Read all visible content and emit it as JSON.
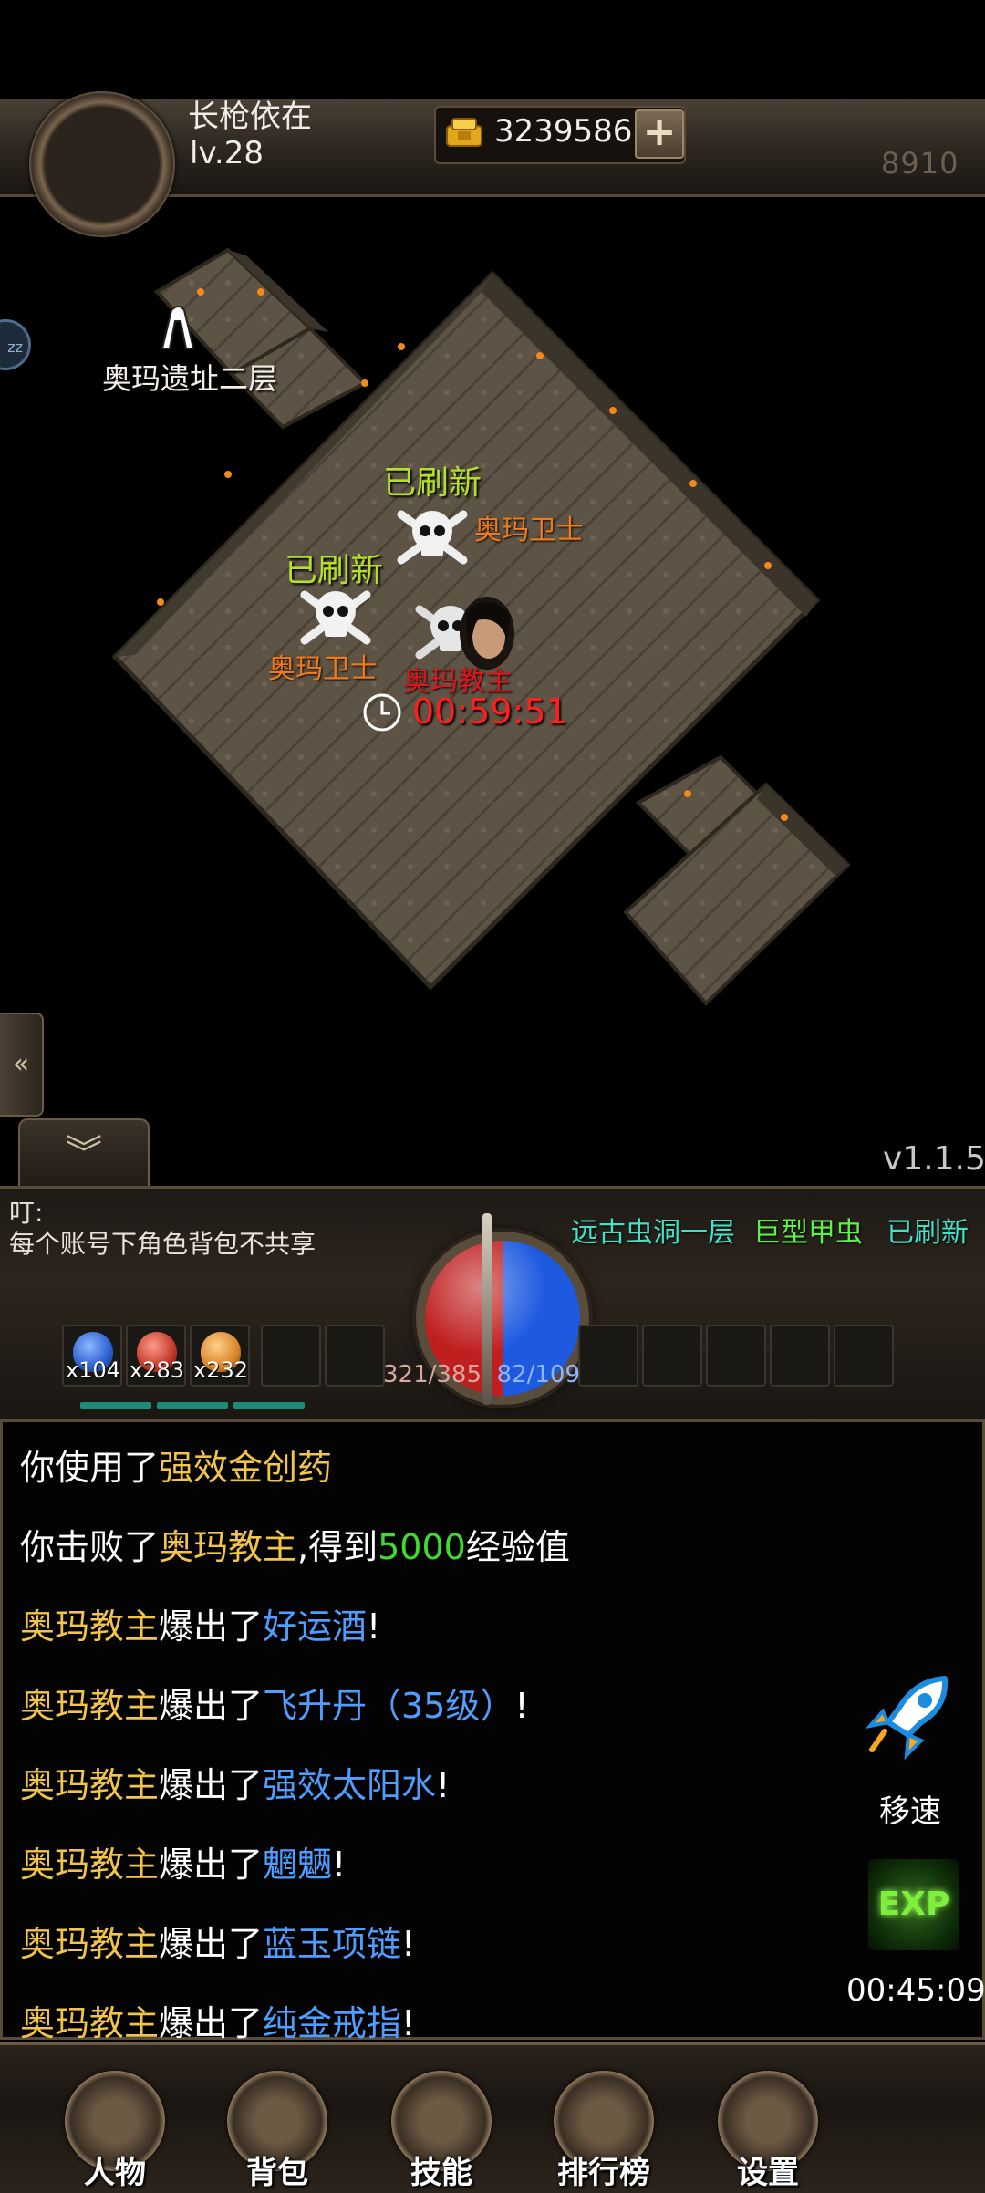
{
  "player": {
    "name": "长枪依在",
    "level": "lv.28",
    "gold": "3239586",
    "power": "8910"
  },
  "sidebar": {
    "zz_badge": "zz"
  },
  "map": {
    "exit_label": "奥玛遗址二层",
    "refresh_1": "已刷新",
    "refresh_2": "已刷新",
    "guard_1": "奥玛卫士",
    "guard_2": "奥玛卫士",
    "boss_name": "奥玛教主",
    "boss_timer": "00:59:51"
  },
  "version": "v1.1.5",
  "notice": {
    "title": "叮:",
    "text": "每个账号下角色背包不共享"
  },
  "status": {
    "location": "远古虫洞一层",
    "monster": "巨型甲虫",
    "state": "已刷新"
  },
  "hud": {
    "potions": [
      {
        "count": "x104",
        "color": "#2a5fd0"
      },
      {
        "count": "x283",
        "color": "#c23a2a"
      },
      {
        "count": "x232",
        "color": "#d9862a"
      }
    ],
    "hp": "321/385",
    "mp": "82/109"
  },
  "chat": [
    [
      {
        "t": "你使用了",
        "c": "w"
      },
      {
        "t": "强效金创药",
        "c": "y"
      }
    ],
    [
      {
        "t": "你击败了",
        "c": "w"
      },
      {
        "t": "奥玛教主",
        "c": "y"
      },
      {
        "t": ",得到",
        "c": "w"
      },
      {
        "t": "5000",
        "c": "g"
      },
      {
        "t": "经验值",
        "c": "w"
      }
    ],
    [
      {
        "t": "奥玛教主",
        "c": "y"
      },
      {
        "t": "爆出了",
        "c": "w"
      },
      {
        "t": "好运酒",
        "c": "b"
      },
      {
        "t": "!",
        "c": "w"
      }
    ],
    [
      {
        "t": "奥玛教主",
        "c": "y"
      },
      {
        "t": "爆出了",
        "c": "w"
      },
      {
        "t": "飞升丹（35级）",
        "c": "b"
      },
      {
        "t": "!",
        "c": "w"
      }
    ],
    [
      {
        "t": "奥玛教主",
        "c": "y"
      },
      {
        "t": "爆出了",
        "c": "w"
      },
      {
        "t": "强效太阳水",
        "c": "b"
      },
      {
        "t": "!",
        "c": "w"
      }
    ],
    [
      {
        "t": "奥玛教主",
        "c": "y"
      },
      {
        "t": "爆出了",
        "c": "w"
      },
      {
        "t": "魍魉",
        "c": "b"
      },
      {
        "t": "!",
        "c": "w"
      }
    ],
    [
      {
        "t": "奥玛教主",
        "c": "y"
      },
      {
        "t": "爆出了",
        "c": "w"
      },
      {
        "t": "蓝玉项链",
        "c": "b"
      },
      {
        "t": "!",
        "c": "w"
      }
    ],
    [
      {
        "t": "奥玛教主",
        "c": "y"
      },
      {
        "t": "爆出了",
        "c": "w"
      },
      {
        "t": "纯金戒指",
        "c": "b"
      },
      {
        "t": "!",
        "c": "w"
      }
    ]
  ],
  "side": {
    "speed_label": "移速",
    "exp_label": "EXP",
    "exp_timer": "00:45:09"
  },
  "nav": [
    {
      "label": "人物",
      "icon": "character-icon"
    },
    {
      "label": "背包",
      "icon": "bag-icon"
    },
    {
      "label": "技能",
      "icon": "skill-icon"
    },
    {
      "label": "排行榜",
      "icon": "ranking-icon"
    },
    {
      "label": "设置",
      "icon": "settings-icon"
    }
  ]
}
